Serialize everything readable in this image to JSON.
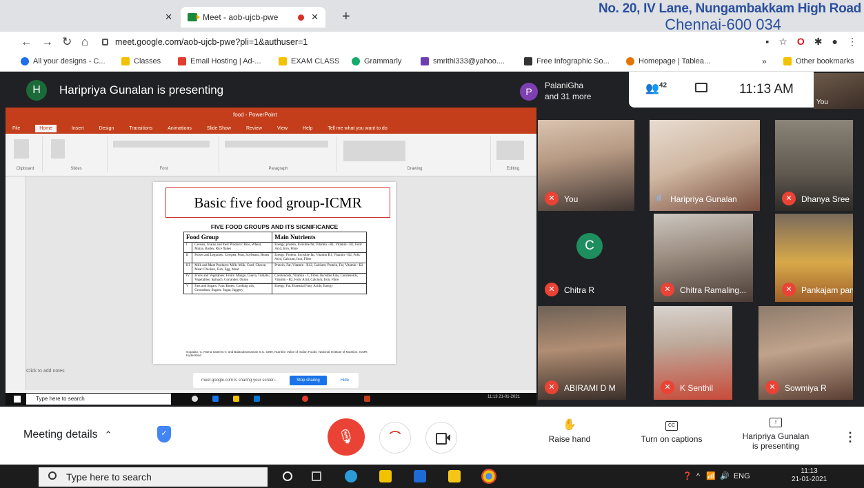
{
  "browser": {
    "tabs": [
      {
        "label": "",
        "active": false
      },
      {
        "label": "Meet - aob-ujcb-pwe",
        "active": true
      }
    ],
    "new_tab": "+",
    "url": "meet.google.com/aob-ujcb-pwe?pli=1&authuser=1",
    "header_line_1": "No. 20, IV Lane, Nungambakkam High Road",
    "header_line_2": "Chennai-600 034",
    "bookmarks": [
      {
        "label": "All your designs - C...",
        "icon_color": "#1f6feb"
      },
      {
        "label": "Classes",
        "icon_color": "#f2c200"
      },
      {
        "label": "Email Hosting | Ad-...",
        "icon_color": "#e23c2c"
      },
      {
        "label": "EXAM CLASS",
        "icon_color": "#f2c200"
      },
      {
        "label": "Grammarly",
        "icon_color": "#15a96a"
      },
      {
        "label": "smrithi333@yahoo....",
        "icon_color": "#6b3fb0"
      },
      {
        "label": "Free Infographic So...",
        "icon_color": "#333333"
      },
      {
        "label": "Homepage | Tablea...",
        "icon_color": "#e37400"
      },
      {
        "label": "Other bookmarks",
        "icon_color": "#f2c200"
      }
    ]
  },
  "meet": {
    "presenter_initial": "H",
    "presenting_text": "Haripriya Gunalan is presenting",
    "others_initial": "P",
    "others_line_1": "PalaniGha",
    "others_line_2": "and 31 more",
    "people_count": "42",
    "time": "11:13 AM",
    "self_label": "You"
  },
  "shared_screen": {
    "app_title": "food - PowerPoint",
    "ribbon_tabs": [
      "File",
      "Home",
      "Insert",
      "Design",
      "Transitions",
      "Animations",
      "Slide Show",
      "Review",
      "View",
      "Help",
      "Tell me what you want to do"
    ],
    "ribbon_groups": [
      "Clipboard",
      "Slides",
      "Font",
      "Paragraph",
      "Drawing",
      "Editing"
    ],
    "slide_title": "Basic five food group-ICMR",
    "table_heading": "FIVE FOOD GROUPS AND ITS SIGNIFICANCE",
    "table_headers": [
      "Food Group",
      "Main Nutrients"
    ],
    "table_rows": [
      {
        "num": "I",
        "group": "Cereals, Grains and their Products: Rice, Wheat, Maize, Barley, Rice flakes",
        "nutrients": "Energy, protein, Invisible fat, Vitamin - B1, Vitamin - B2, Folic Acid, Iron, Fibre"
      },
      {
        "num": "II",
        "group": "Pulses and Legumes: Cowpea, Peas, Soybeans, Beans",
        "nutrients": "Energy, Protein, Invisible fat, Vitamin B1, Vitamin - B2, Folic Acid, Calcium, Iron, Fibre"
      },
      {
        "num": "III",
        "group": "Milk and Meat Products: Milk: Milk, Curd, Cheese; Meat: Chicken, Fish, Egg, Meat",
        "nutrients": "Protein, Fat, Vitamin - B12, Calcium; Protein, Fat, Vitamin - B2"
      },
      {
        "num": "IV",
        "group": "Fruits and Vegetables: Fruits: Mango, Guava, Tomato; Vegetables: Spinach, Coriander, Onion",
        "nutrients": "Carotenoids, Vitamin - C, Fibre, Invisible Fats, Carotenoids, Vitamin - B2, Folic Acid, Calcium, Iron, Fibre"
      },
      {
        "num": "V",
        "group": "Fats and Sugars: Fats: Butter, Cooking oils, Groundnut; Sugars: Sugar, Jaggery",
        "nutrients": "Energy, Fat, Essential Fatty Acids; Energy"
      }
    ],
    "source_note": "Gopalan, C. Rama Sastri B.V. and Balasubramanian S.C. 1989, Nutritive Value of Indian Foods, National Institute of Nutrition, ICMR, Hyderabad",
    "notes_placeholder": "Click to add notes",
    "share_banner": "meet.google.com is sharing your screen.",
    "stop_sharing": "Stop sharing",
    "hide": "Hide",
    "taskbar_search": "Type here to search",
    "taskbar_time": "11:13",
    "taskbar_date": "21-01-2021"
  },
  "participants": [
    {
      "name": "You",
      "muted": true
    },
    {
      "name": "Haripriya Gunalan",
      "muted": false
    },
    {
      "name": "Dhanya Sree",
      "muted": true
    },
    {
      "name": "Chitra R",
      "muted": true,
      "initial": "C"
    },
    {
      "name": "Chitra Ramaling...",
      "muted": true
    },
    {
      "name": "Pankajam panka...",
      "muted": true
    },
    {
      "name": "ABIRAMI D M",
      "muted": true
    },
    {
      "name": "K Senthil",
      "muted": true
    },
    {
      "name": "Sowmiya R",
      "muted": true
    }
  ],
  "controls": {
    "meeting_details": "Meeting details",
    "raise_hand": "Raise hand",
    "captions": "Turn on captions",
    "presenting_line_1": "Haripriya Gunalan",
    "presenting_line_2": "is presenting"
  },
  "taskbar": {
    "search": "Type here to search",
    "lang": "ENG",
    "time": "11:13",
    "date": "21-01-2021"
  },
  "colors": {
    "meet_bg": "#202124",
    "mute_red": "#ea4335",
    "ppt_red": "#c43e1c",
    "header_blue": "#2a4f9e"
  }
}
